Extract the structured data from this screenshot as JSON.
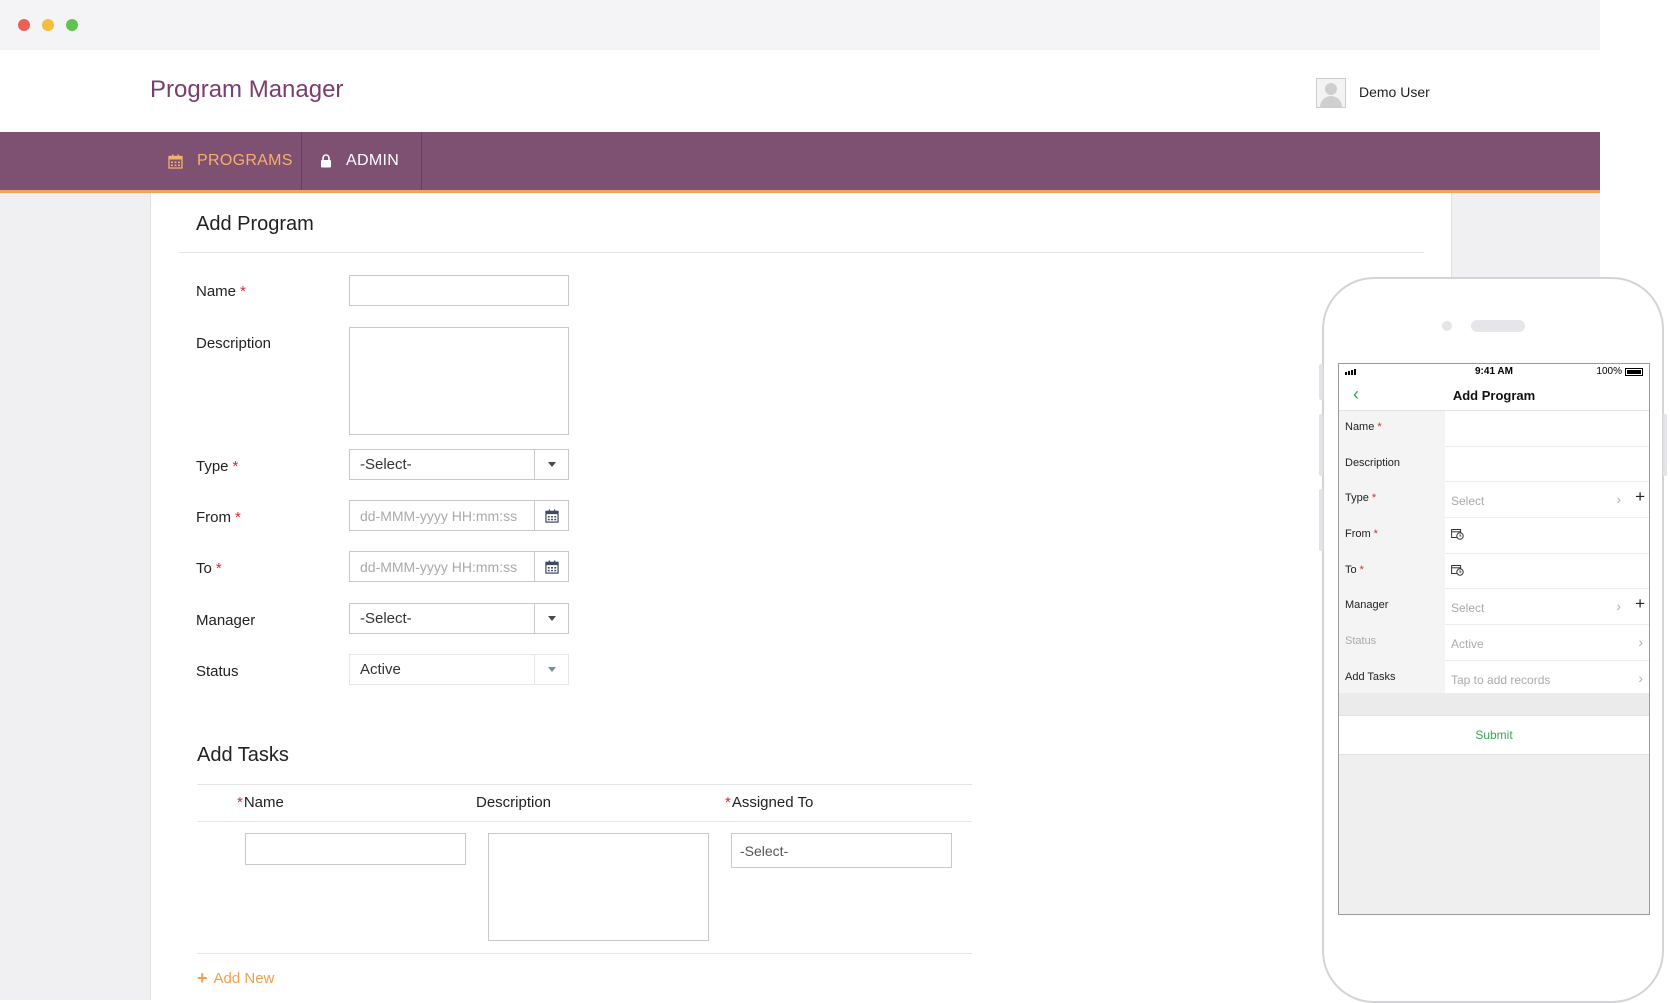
{
  "header": {
    "app_title": "Program Manager",
    "user_name": "Demo User"
  },
  "nav": {
    "programs_label": "PROGRAMS",
    "admin_label": "ADMIN"
  },
  "form": {
    "title": "Add Program",
    "fields": {
      "name": {
        "label": "Name",
        "required": "*"
      },
      "description": {
        "label": "Description"
      },
      "type": {
        "label": "Type",
        "required": "*",
        "value": "-Select-"
      },
      "from": {
        "label": "From",
        "required": "*",
        "placeholder": "dd-MMM-yyyy HH:mm:ss"
      },
      "to": {
        "label": "To",
        "required": "*",
        "placeholder": "dd-MMM-yyyy HH:mm:ss"
      },
      "manager": {
        "label": "Manager",
        "value": "-Select-"
      },
      "status": {
        "label": "Status",
        "value": "Active"
      }
    }
  },
  "tasks": {
    "title": "Add Tasks",
    "columns": {
      "name": "Name",
      "description": "Description",
      "assigned_to": "Assigned To",
      "required": "*"
    },
    "assigned_value": "-Select-",
    "add_new_label": "Add New"
  },
  "mobile": {
    "status": {
      "time": "9:41 AM",
      "battery": "100%"
    },
    "title": "Add Program",
    "rows": {
      "name": "Name",
      "description": "Description",
      "type": "Type",
      "type_value": "Select",
      "from": "From",
      "to": "To",
      "manager": "Manager",
      "manager_value": "Select",
      "status": "Status",
      "status_value": "Active",
      "add_tasks": "Add Tasks",
      "add_tasks_value": "Tap to add records",
      "required": "*"
    },
    "submit_label": "Submit"
  },
  "colors": {
    "brand_purple": "#7e5071",
    "title_purple": "#7a3e6e",
    "accent_orange": "#f0a45d",
    "required_red": "#e0262c",
    "mobile_green": "#3aa651"
  },
  "icons": {
    "programs": "calendar-icon",
    "admin": "lock-icon",
    "date": "calendar-icon",
    "add": "plus-icon",
    "back": "chevron-left-icon"
  }
}
